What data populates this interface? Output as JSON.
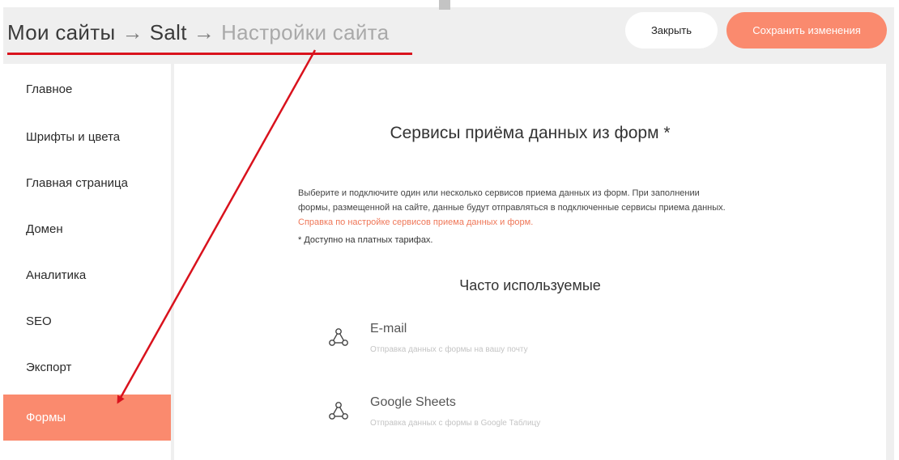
{
  "breadcrumb": {
    "items": [
      "Мои сайты",
      "Salt"
    ],
    "current": "Настройки сайта",
    "separator": "→"
  },
  "header": {
    "close_label": "Закрыть",
    "save_label": "Сохранить изменения"
  },
  "sidebar": {
    "items": [
      {
        "label": "Главное"
      },
      {
        "label": "Шрифты и цвета"
      },
      {
        "label": "Главная страница"
      },
      {
        "label": "Домен"
      },
      {
        "label": "Аналитика"
      },
      {
        "label": "SEO"
      },
      {
        "label": "Экспорт"
      },
      {
        "label": "Формы",
        "active": true
      }
    ]
  },
  "main": {
    "title": "Сервисы приёма данных из форм *",
    "description_line1": "Выберите и подключите один или несколько сервисов приема данных из форм. При заполнении",
    "description_line2": "формы, размещенной на сайте, данные будут отправляться в подключенные сервисы приема данных.",
    "help_link": "Справка по настройке сервисов приема данных и форм.",
    "note": "* Доступно на платных тарифах.",
    "section_title": "Часто используемые",
    "services": [
      {
        "name": "E-mail",
        "description": "Отправка данных с формы на вашу почту",
        "icon": "service-nodes-icon"
      },
      {
        "name": "Google Sheets",
        "description": "Отправка данных с формы в Google Таблицу",
        "icon": "service-nodes-icon"
      }
    ]
  },
  "colors": {
    "accent": "#fa8a6e",
    "annotation_red": "#d9121d",
    "background": "#efefef"
  }
}
